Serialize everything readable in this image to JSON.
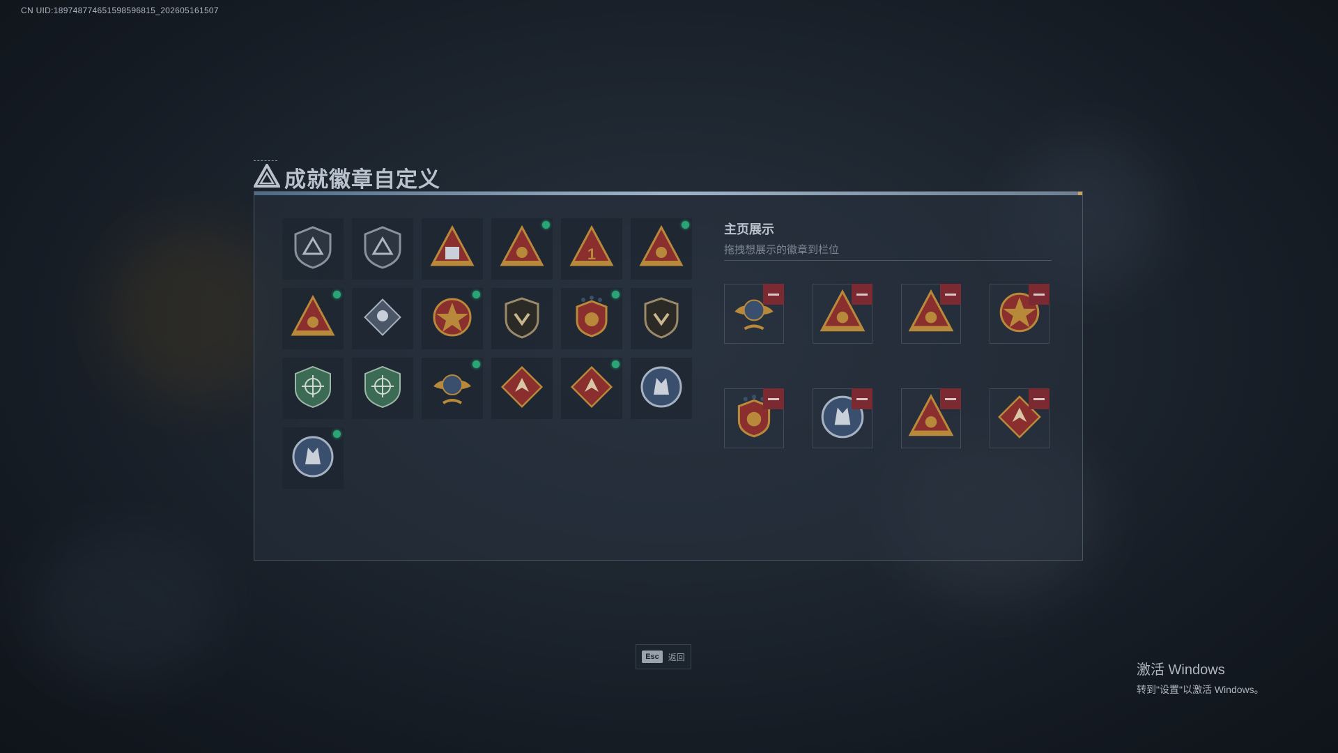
{
  "uid_text": "CN UID:18974877465159859681​5_202605161507",
  "title": "成就徽章自定义",
  "badges": [
    {
      "icon": "shield-triangle-badge-icon",
      "new": false
    },
    {
      "icon": "helicopter-shield-badge-icon",
      "new": false
    },
    {
      "icon": "number-58-triangle-badge-icon",
      "new": false
    },
    {
      "icon": "boat-triangle-badge-icon",
      "new": true
    },
    {
      "icon": "number-1-triangle-badge-icon",
      "new": false
    },
    {
      "icon": "soldier-triangle-badge-icon",
      "new": true
    },
    {
      "icon": "mountain-soldier-badge-icon",
      "new": true
    },
    {
      "icon": "diamond-armor-badge-icon",
      "new": false
    },
    {
      "icon": "star-emblem-badge-icon",
      "new": true
    },
    {
      "icon": "shield-arrow-badge-icon",
      "new": false
    },
    {
      "icon": "stars-crest-badge-icon",
      "new": true
    },
    {
      "icon": "lion-shield-badge-icon",
      "new": false
    },
    {
      "icon": "green-crosshair-shield-badge-icon",
      "new": false
    },
    {
      "icon": "green-crosshair-shield-2-badge-icon",
      "new": false
    },
    {
      "icon": "wings-target-badge-icon",
      "new": true
    },
    {
      "icon": "dragon-diamond-badge-icon",
      "new": false
    },
    {
      "icon": "dragon-diamond-2-badge-icon",
      "new": true
    },
    {
      "icon": "wolf-round-badge-icon",
      "new": false
    },
    {
      "icon": "wolf-round-2-badge-icon",
      "new": true
    }
  ],
  "showcase": {
    "title": "主页展示",
    "subtitle": "拖拽想展示的徽章到栏位",
    "slots": [
      {
        "icon": "wings-target-badge-icon"
      },
      {
        "icon": "helmet-triangle-badge-icon"
      },
      {
        "icon": "soldier-triangle-badge-icon"
      },
      {
        "icon": "star-emblem-badge-icon"
      },
      {
        "icon": "stars-crest-badge-icon"
      },
      {
        "icon": "wolf-round-badge-icon"
      },
      {
        "icon": "mountain-soldier-badge-icon"
      },
      {
        "icon": "dragon-diamond-badge-icon"
      }
    ]
  },
  "footer": {
    "esc_key": "Esc",
    "esc_label": "返回"
  },
  "watermark": {
    "title": "激活 Windows",
    "sub": "转到\"设置\"以激活 Windows。"
  },
  "colors": {
    "accent_new": "#2aa676",
    "remove": "#7a2a30",
    "gold": "#b8893a"
  }
}
